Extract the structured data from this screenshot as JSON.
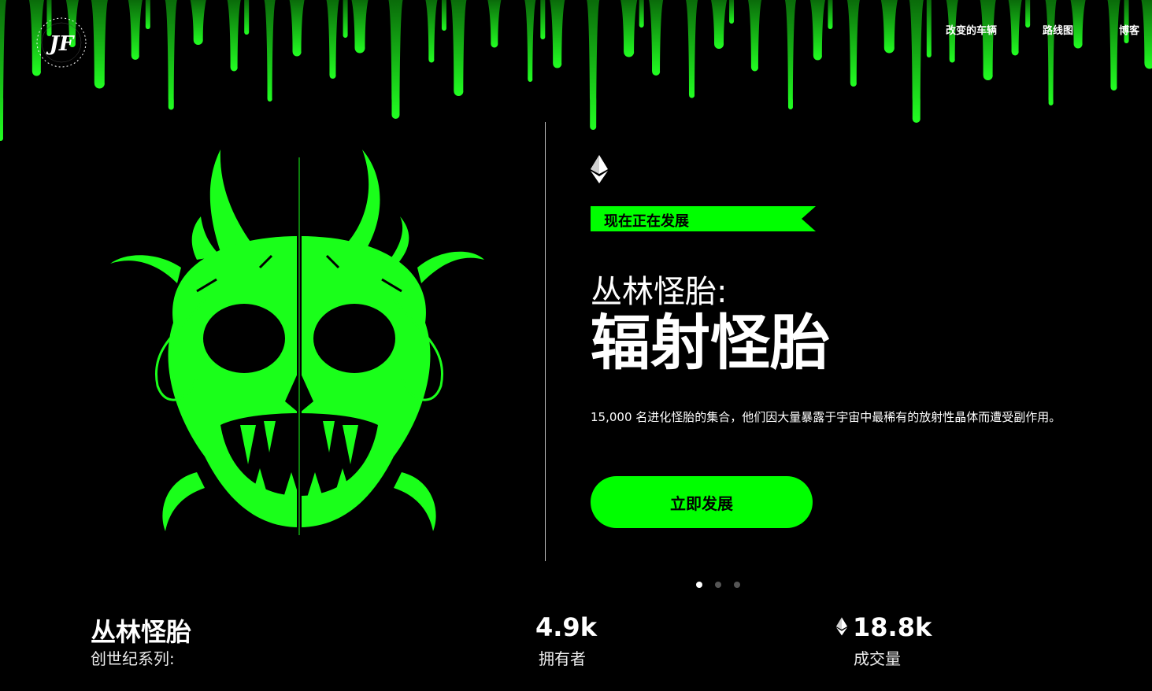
{
  "brand": {
    "logo_letters": "JF"
  },
  "nav": {
    "items": [
      "改变的车辆",
      "路线图",
      "博客"
    ]
  },
  "hero": {
    "ribbon": "现在正在发展",
    "kicker": "丛林怪胎:",
    "headline": "辐射怪胎",
    "description": "15,000 名进化怪胎的集合，他们因大量暴露于宇宙中最稀有的放射性晶体而遭受副作用。",
    "cta": "立即发展"
  },
  "carousel": {
    "slide_count": 3,
    "active_index": 0
  },
  "stats": {
    "collection": {
      "title": "丛林怪胎",
      "subtitle": "创世纪系列:"
    },
    "owners": {
      "value": "4.9k",
      "label": "拥有者"
    },
    "volume": {
      "value": "18.8k",
      "label": "成交量"
    }
  },
  "colors": {
    "accent": "#00ff00",
    "background": "#000000",
    "text": "#ffffff"
  },
  "icons": {
    "currency": "ethereum-icon",
    "art": "demon-skull-illustration"
  }
}
